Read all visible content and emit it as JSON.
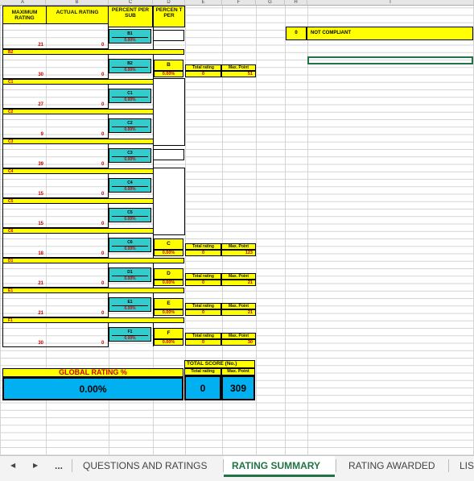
{
  "columns": [
    "A",
    "B",
    "C",
    "D",
    "E",
    "F",
    "G",
    "H",
    "I"
  ],
  "headers": {
    "maximum_rating": "MAXIMUM RATING",
    "actual_rating": "ACTUAL RATING",
    "percent_per_sub": "PERCENT PER SUB",
    "percent_per": "PERCEN T PER"
  },
  "status": {
    "value": "0",
    "text": "NOT COMPLIANT"
  },
  "rows": [
    {
      "max": "21",
      "actual": "0",
      "code": "B1",
      "bar_label": "B2"
    },
    {
      "max": "30",
      "actual": "0",
      "code": "B2",
      "bar_label": "C1"
    },
    {
      "max": "27",
      "actual": "0",
      "code": "C1",
      "bar_label": "C2"
    },
    {
      "max": "9",
      "actual": "0",
      "code": "C2",
      "bar_label": "C3"
    },
    {
      "max": "39",
      "actual": "0",
      "code": "C3",
      "bar_label": "C4"
    },
    {
      "max": "15",
      "actual": "0",
      "code": "C4",
      "bar_label": "C5"
    },
    {
      "max": "15",
      "actual": "0",
      "code": "C5",
      "bar_label": "C6"
    },
    {
      "max": "18",
      "actual": "0",
      "code": "C6",
      "bar_label": "D1"
    },
    {
      "max": "21",
      "actual": "0",
      "code": "D1",
      "bar_label": "E1"
    },
    {
      "max": "21",
      "actual": "0",
      "code": "E1",
      "bar_label": "F1"
    },
    {
      "max": "30",
      "actual": "0",
      "code": "F1",
      "bar_label": ""
    }
  ],
  "sub_pct": "0.00%",
  "group_pct": "0.00%",
  "groups": [
    {
      "letter": "B",
      "pct": "0.00%",
      "total_label": "Total rating",
      "max_label": "Max. Point",
      "total": "0",
      "max": "51"
    },
    {
      "letter": "C",
      "pct": "0.00%",
      "total_label": "Total rating",
      "max_label": "Max. Point",
      "total": "0",
      "max": "123"
    },
    {
      "letter": "D",
      "pct": "0.00%",
      "total_label": "Total rating",
      "max_label": "Max. Point",
      "total": "0",
      "max": "21"
    },
    {
      "letter": "E",
      "pct": "0.00%",
      "total_label": "Total rating",
      "max_label": "Max. Point",
      "total": "0",
      "max": "21"
    },
    {
      "letter": "F",
      "pct": "0.00%",
      "total_label": "Total rating",
      "max_label": "Max. Point",
      "total": "0",
      "max": "30"
    }
  ],
  "total_score": {
    "title": "TOTAL SCORE (No.)",
    "total_label": "Total rating",
    "max_label": "Max. Point",
    "total": "0",
    "max": "309"
  },
  "global": {
    "label": "GLOBAL RATING %",
    "value": "0.00%"
  },
  "tabs": {
    "prev": "◀",
    "next": "▶",
    "more": "...",
    "items": [
      "QUESTIONS AND RATINGS",
      "RATING SUMMARY",
      "RATING AWARDED",
      "LIS"
    ],
    "active_index": 1
  }
}
